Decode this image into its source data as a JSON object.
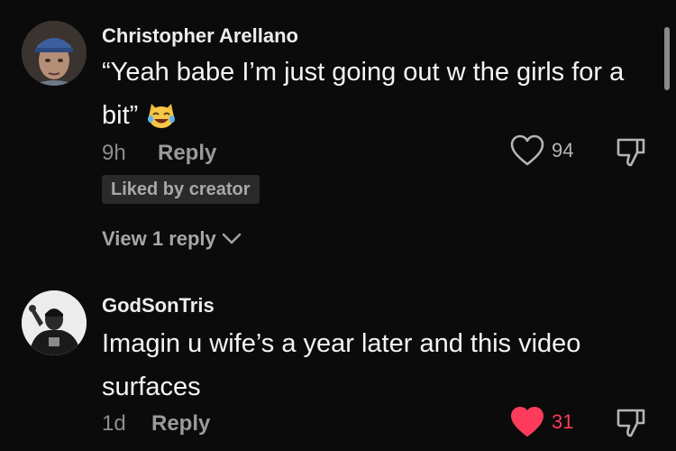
{
  "comments": [
    {
      "username": "Christopher Arellano",
      "text": "“Yeah babe I’m just going out w the girls for a bit”",
      "emoji": "laughing-cat-emoji",
      "time": "9h",
      "reply_label": "Reply",
      "likes": "94",
      "liked": false,
      "badge": "Liked by creator",
      "view_replies": "View 1 reply"
    },
    {
      "username": "GodSonTris",
      "text": "Imagin u wife’s a year later and this video surfaces",
      "time": "1d",
      "reply_label": "Reply",
      "likes": "31",
      "liked": true
    }
  ],
  "colors": {
    "accent_like": "#ff3b5c",
    "background": "#0b0b0b"
  }
}
